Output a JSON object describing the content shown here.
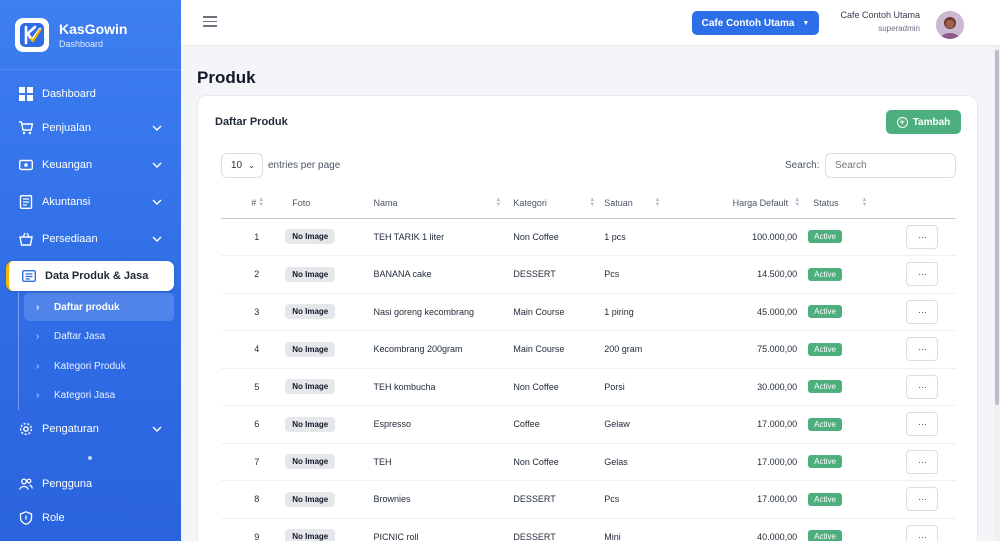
{
  "app": {
    "name": "KasGowin",
    "subtitle": "Dashboard"
  },
  "sidebar": {
    "items": [
      {
        "label": "Dashboard"
      },
      {
        "label": "Penjualan"
      },
      {
        "label": "Keuangan"
      },
      {
        "label": "Akuntansi"
      },
      {
        "label": "Persediaan"
      },
      {
        "label": "Data Produk & Jasa"
      },
      {
        "label": "Pengaturan"
      },
      {
        "label": "Pengguna"
      },
      {
        "label": "Role"
      }
    ],
    "subitems": [
      {
        "label": "Daftar produk"
      },
      {
        "label": "Daftar Jasa"
      },
      {
        "label": "Kategori Produk"
      },
      {
        "label": "Kategori Jasa"
      }
    ]
  },
  "topbar": {
    "outlet_button": "Cafe Contoh Utama",
    "user_outlet": "Cafe Contoh Utama",
    "user_role": "superadmin"
  },
  "page": {
    "title": "Produk"
  },
  "card": {
    "title": "Daftar Produk",
    "add_button": "Tambah",
    "per_page_value": "10",
    "per_page_label": "entries per page",
    "search_label": "Search:",
    "search_placeholder": "Search"
  },
  "table": {
    "headers": [
      "#",
      "Foto",
      "Nama",
      "Kategori",
      "Satuan",
      "Harga Default",
      "Status"
    ],
    "rows": [
      {
        "no": "1",
        "foto": "No Image",
        "nama": "TEH TARIK 1 liter",
        "kategori": "Non Coffee",
        "satuan": "1 pcs",
        "harga": "100.000,00",
        "status": "Active"
      },
      {
        "no": "2",
        "foto": "No Image",
        "nama": "BANANA cake",
        "kategori": "DESSERT",
        "satuan": "Pcs",
        "harga": "14.500,00",
        "status": "Active"
      },
      {
        "no": "3",
        "foto": "No Image",
        "nama": "Nasi goreng kecombrang",
        "kategori": "Main Course",
        "satuan": "1 piring",
        "harga": "45.000,00",
        "status": "Active"
      },
      {
        "no": "4",
        "foto": "No Image",
        "nama": "Kecombrang 200gram",
        "kategori": "Main Course",
        "satuan": "200 gram",
        "harga": "75.000,00",
        "status": "Active"
      },
      {
        "no": "5",
        "foto": "No Image",
        "nama": "TEH kombucha",
        "kategori": "Non Coffee",
        "satuan": "Porsi",
        "harga": "30.000,00",
        "status": "Active"
      },
      {
        "no": "6",
        "foto": "No Image",
        "nama": "Espresso",
        "kategori": "Coffee",
        "satuan": "Gelaw",
        "harga": "17.000,00",
        "status": "Active"
      },
      {
        "no": "7",
        "foto": "No Image",
        "nama": "TEH",
        "kategori": "Non Coffee",
        "satuan": "Gelas",
        "harga": "17.000,00",
        "status": "Active"
      },
      {
        "no": "8",
        "foto": "No Image",
        "nama": "Brownies",
        "kategori": "DESSERT",
        "satuan": "Pcs",
        "harga": "17.000,00",
        "status": "Active"
      },
      {
        "no": "9",
        "foto": "No Image",
        "nama": "PICNIC roll",
        "kategori": "DESSERT",
        "satuan": "Mini",
        "harga": "40.000,00",
        "status": "Active"
      }
    ],
    "action_label": "···"
  },
  "colors": {
    "primary": "#2d6fe8",
    "success": "#4caf7d",
    "accent": "#f5b400"
  }
}
